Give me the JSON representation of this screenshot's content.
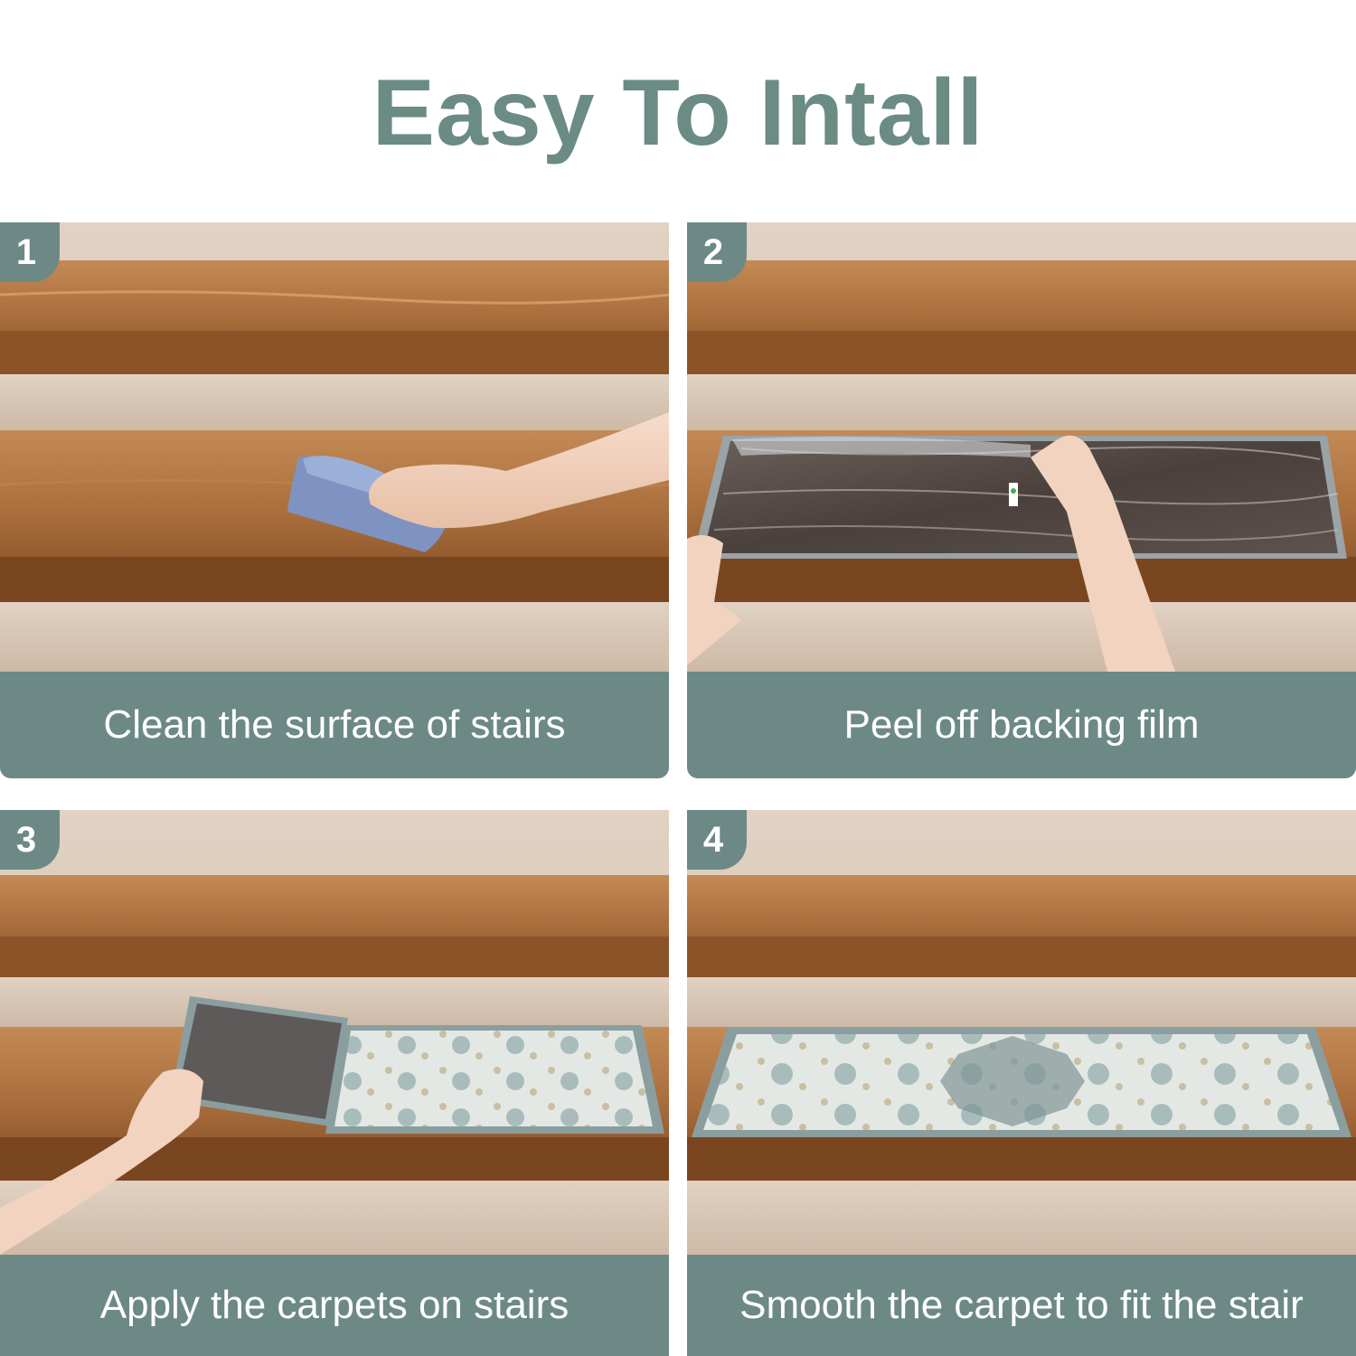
{
  "title": "Easy To Intall",
  "steps": [
    {
      "number": "1",
      "caption": "Clean the surface of stairs"
    },
    {
      "number": "2",
      "caption": "Peel off backing film"
    },
    {
      "number": "3",
      "caption": "Apply the carpets on stairs"
    },
    {
      "number": "4",
      "caption": "Smooth the carpet to fit the stair"
    }
  ],
  "colors": {
    "accent": "#6d8985",
    "title": "#6b8b85",
    "wood": "#a0693a",
    "wall": "#d9c8b6"
  }
}
